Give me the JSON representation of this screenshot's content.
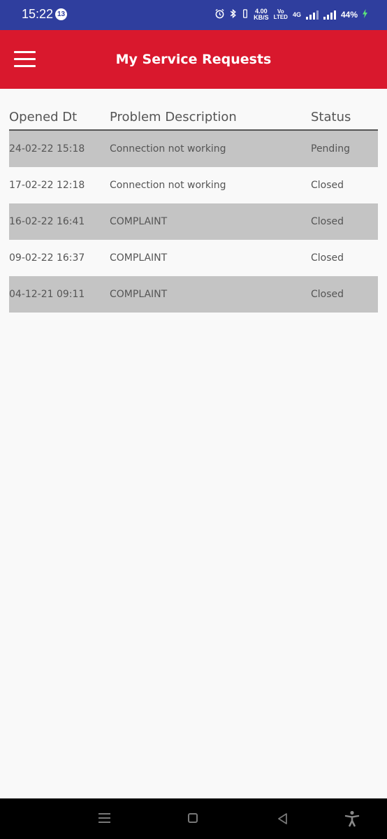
{
  "status_bar": {
    "time": "15:22",
    "notification_count": "13",
    "net_speed_value": "4.00",
    "net_speed_unit": "KB/S",
    "volte_top": "Vo",
    "volte_bottom": "LTED",
    "network_type": "4G",
    "battery": "44%",
    "icons": [
      "alarm-icon",
      "bluetooth-icon",
      "vibrate-icon",
      "signal-icon",
      "battery-charging-icon"
    ]
  },
  "app_bar": {
    "title": "My Service Requests",
    "menu_icon": "hamburger-menu-icon",
    "background": "#d9182d"
  },
  "table": {
    "columns": [
      "Opened Dt",
      "Problem Description",
      "Status"
    ],
    "rows": [
      {
        "opened": "24-02-22 15:18",
        "description": "Connection not working",
        "status": "Pending"
      },
      {
        "opened": "17-02-22 12:18",
        "description": "Connection not working",
        "status": "Closed"
      },
      {
        "opened": "16-02-22 16:41",
        "description": "COMPLAINT",
        "status": "Closed"
      },
      {
        "opened": "09-02-22 16:37",
        "description": "COMPLAINT",
        "status": "Closed"
      },
      {
        "opened": "04-12-21 09:11",
        "description": "COMPLAINT",
        "status": "Closed"
      }
    ],
    "shaded_row_color": "#c4c4c4"
  },
  "nav_bar": {
    "icons": [
      "recents-menu-icon",
      "home-icon",
      "back-icon",
      "accessibility-icon"
    ]
  }
}
